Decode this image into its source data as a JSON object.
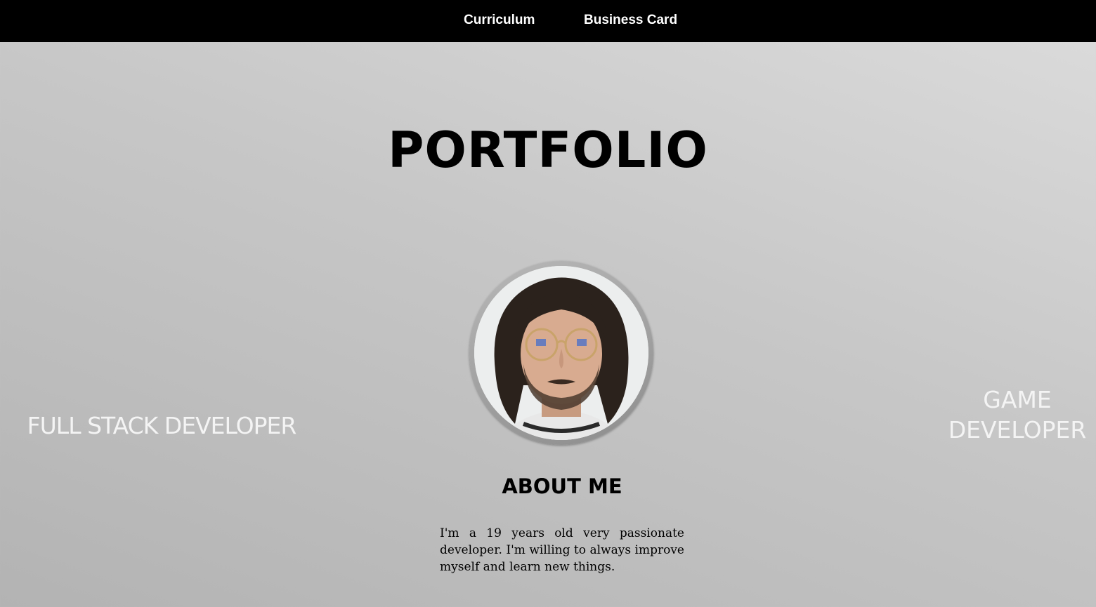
{
  "nav": {
    "items": [
      {
        "label": "Curriculum"
      },
      {
        "label": "Business Card"
      }
    ]
  },
  "hero": {
    "title": "PORTFOLIO",
    "left_role": "FULL STACK DEVELOPER",
    "right_role": "GAME DEVELOPER"
  },
  "profile": {
    "avatar_icon": "profile-photo"
  },
  "about": {
    "heading": "ABOUT ME",
    "text": "I'm a 19 years old very passionate developer. I'm willing to always improve myself and learn new things."
  },
  "colors": {
    "nav_background": "#000000",
    "nav_text": "#ffffff",
    "title_text": "#000000",
    "role_text": "#f4f4f4"
  }
}
